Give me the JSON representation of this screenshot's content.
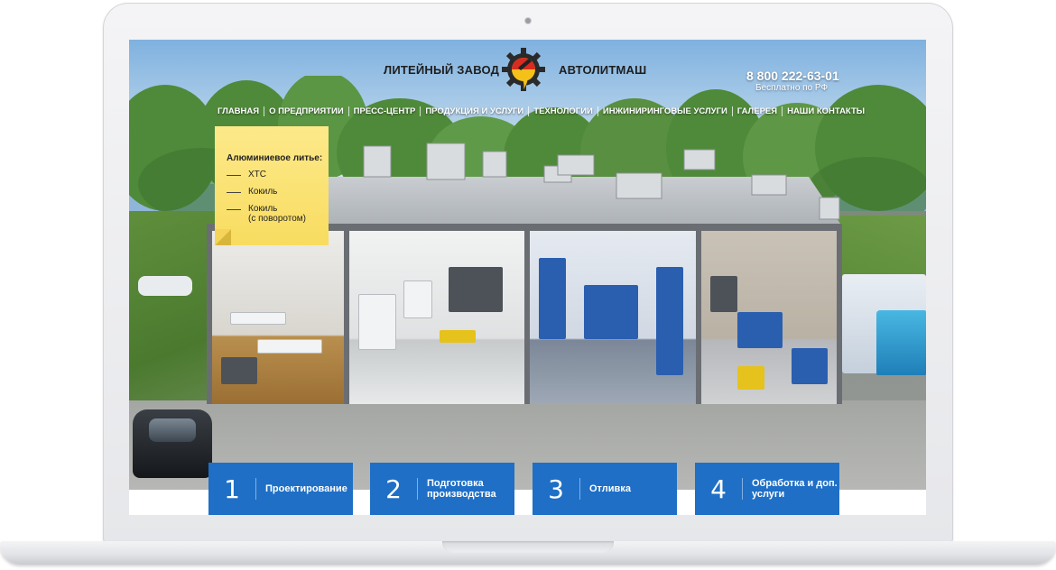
{
  "header": {
    "brand_left": "ЛИТЕЙНЫЙ ЗАВОД",
    "brand_right": "АВТОЛИТМАШ",
    "phone": "8 800 222-63-01",
    "phone_note": "Бесплатно по РФ",
    "logo_icon": "gear-logo-icon"
  },
  "nav": {
    "items": [
      {
        "label": "ГЛАВНАЯ"
      },
      {
        "label": "О ПРЕДПРИЯТИИ"
      },
      {
        "label": "ПРЕСС-ЦЕНТР"
      },
      {
        "label": "ПРОДУКЦИЯ И УСЛУГИ"
      },
      {
        "label": "ТЕХНОЛОГИИ"
      },
      {
        "label": "ИНЖИНИРИНГОВЫЕ УСЛУГИ"
      },
      {
        "label": "ГАЛЕРЕЯ"
      },
      {
        "label": "НАШИ КОНТАКТЫ"
      }
    ]
  },
  "note": {
    "title": "Алюминиевое литье:",
    "items": [
      {
        "label": "ХТС"
      },
      {
        "label": "Кокиль"
      },
      {
        "label": "Кокиль"
      },
      {
        "label": "(с поворотом)"
      }
    ]
  },
  "steps": [
    {
      "num": "1",
      "label": "Проектирование"
    },
    {
      "num": "2",
      "label": "Подготовка производства"
    },
    {
      "num": "3",
      "label": "Отливка"
    },
    {
      "num": "4",
      "label": "Обработка и доп. услуги"
    }
  ],
  "colors": {
    "step_blue": "#1f6fc6",
    "note_yellow": "#fde98a",
    "logo_red": "#d92b20",
    "logo_yellow": "#f4c01a"
  }
}
